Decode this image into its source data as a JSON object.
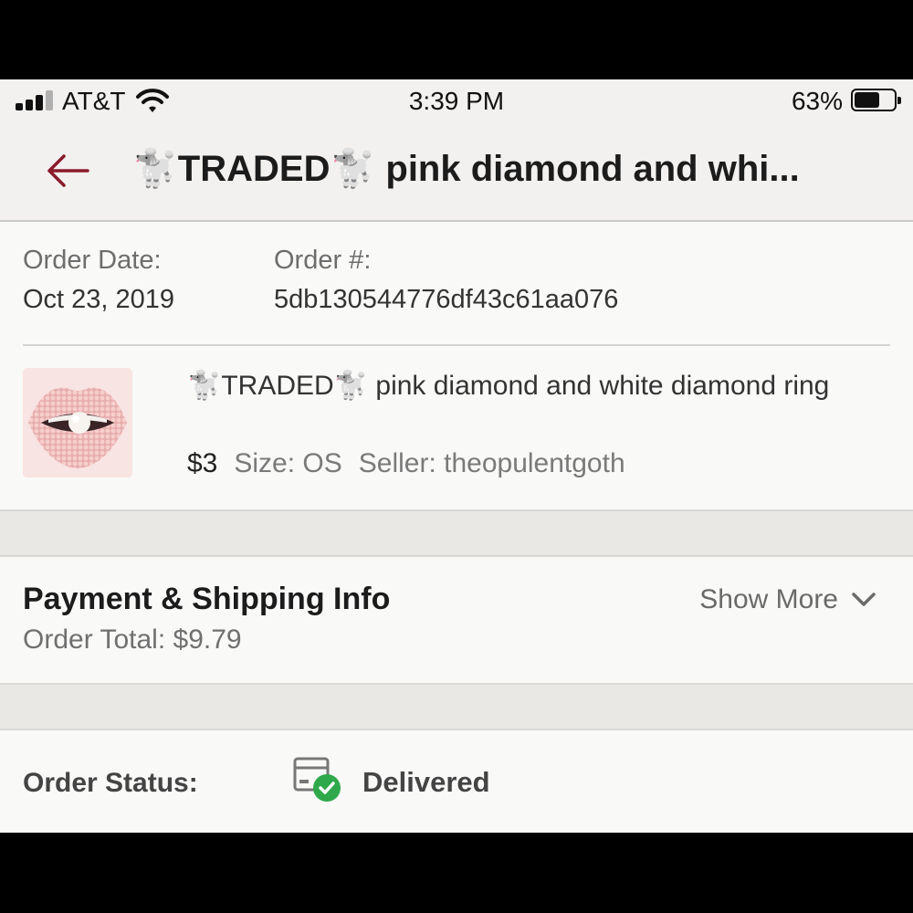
{
  "status_bar": {
    "carrier": "AT&T",
    "time": "3:39 PM",
    "battery_percent": "63%",
    "battery_level": 0.63
  },
  "header": {
    "title": "🐩TRADED🐩 pink diamond and whi..."
  },
  "order": {
    "date_label": "Order Date:",
    "date_value": "Oct 23, 2019",
    "number_label": "Order #:",
    "number_value": "5db130544776df43c61aa076"
  },
  "item": {
    "title": "🐩TRADED🐩 pink diamond and white diamond ring",
    "price": "$3",
    "size": "Size: OS",
    "seller": "Seller: theopulentgoth"
  },
  "payment": {
    "title": "Payment & Shipping Info",
    "total": "Order Total: $9.79",
    "show_more": "Show More"
  },
  "order_status": {
    "label": "Order Status:",
    "value": "Delivered"
  },
  "colors": {
    "accent": "#8b1a2b",
    "success": "#2ea84a"
  }
}
